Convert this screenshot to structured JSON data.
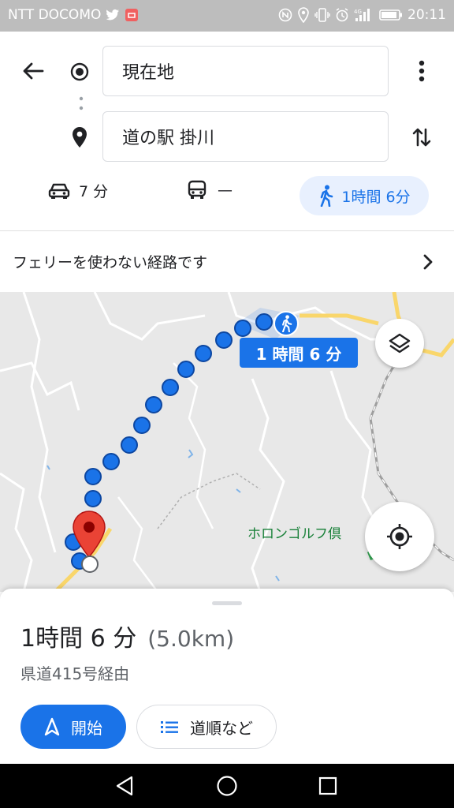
{
  "status_bar": {
    "carrier": "NTT DOCOMO",
    "time": "20:11",
    "icons": [
      "twitter-icon",
      "notification-badge-icon",
      "nfc-icon",
      "location-icon",
      "vibrate-icon",
      "alarm-icon",
      "signal-4g-icon",
      "battery-icon"
    ]
  },
  "search": {
    "origin": "現在地",
    "destination": "道の駅 掛川"
  },
  "modes": [
    {
      "name": "drive",
      "icon": "car-icon",
      "label": "7 分"
    },
    {
      "name": "transit",
      "icon": "bus-icon",
      "label": "—"
    },
    {
      "name": "walk",
      "icon": "walk-icon",
      "label": "1時間 6分",
      "selected": true
    }
  ],
  "ferry_notice": "フェリーを使わない経路です",
  "map": {
    "route_label": "1 時間 6 分",
    "poi_label": "ホロンゴルフ倶",
    "route_color": "#1a73e8",
    "pin_color": "#ea4335"
  },
  "sheet": {
    "duration": "1時間 6 分",
    "distance": "(5.0km)",
    "via": "県道415号経由",
    "start_label": "開始",
    "steps_label": "道順など"
  },
  "colors": {
    "accent": "#1a73e8",
    "status_bar": "#bdbdbd",
    "poi": "#188038"
  }
}
